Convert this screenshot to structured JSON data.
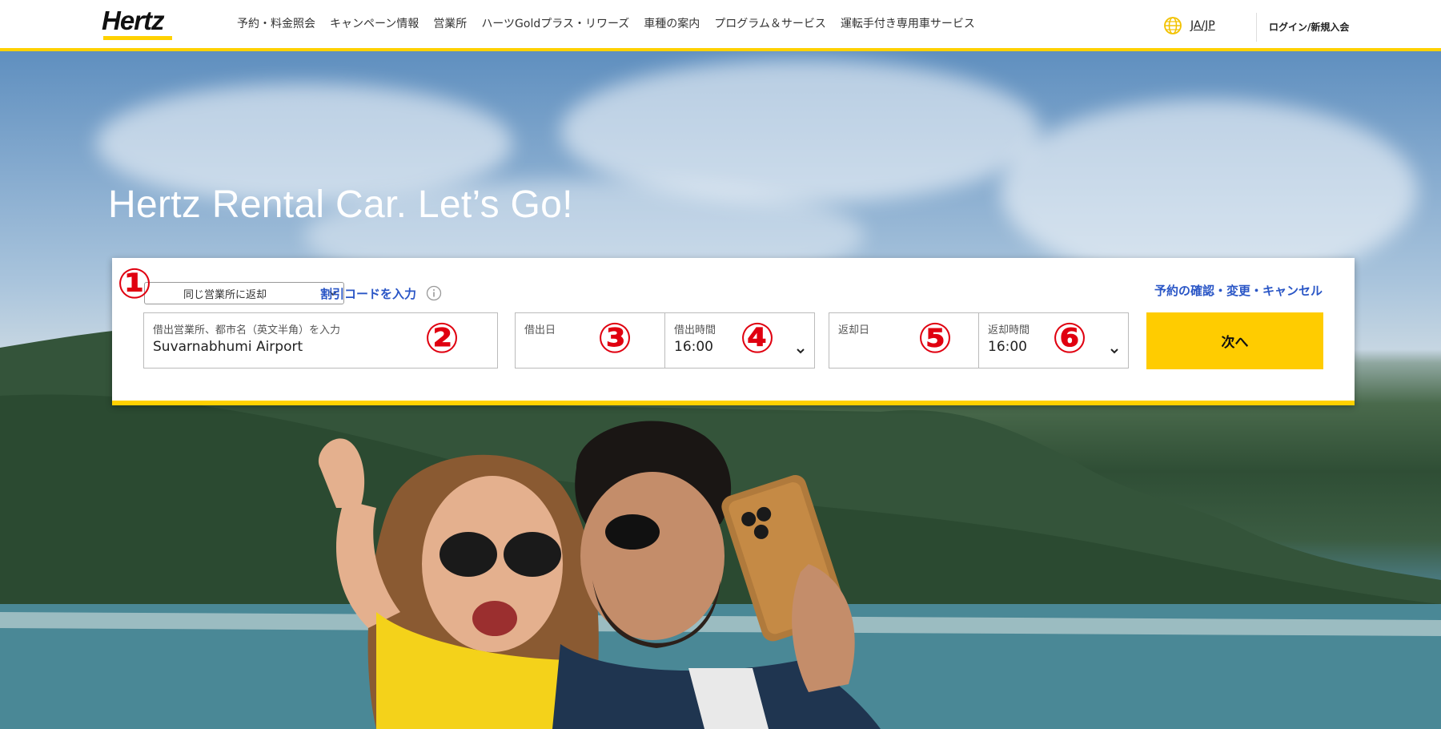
{
  "header": {
    "logo_text": "Hertz",
    "nav": [
      "予約・料金照会",
      "キャンペーン情報",
      "営業所",
      "ハーツGoldプラス・リワーズ",
      "車種の案内",
      "プログラム＆サービス",
      "運転手付き専用車サービス"
    ],
    "language": "JA/JP",
    "login": "ログイン/新規入会"
  },
  "hero": {
    "title": "Hertz Rental Car. Let’s Go!"
  },
  "booking": {
    "return_option": "同じ営業所に返却",
    "discount_link": "割引コードを入力",
    "manage_link": "予約の確認・変更・キャンセル",
    "location_label": "借出営業所、都市名（英文半角）を入力",
    "location_value": "Suvarnabhumi Airport",
    "pickup_date_label": "借出日",
    "pickup_date_value": "",
    "pickup_time_label": "借出時間",
    "pickup_time_value": "16:00",
    "return_date_label": "返却日",
    "return_date_value": "",
    "return_time_label": "返却時間",
    "return_time_value": "16:00",
    "next_label": "次へ"
  },
  "annotations": [
    "①",
    "②",
    "③",
    "④",
    "⑤",
    "⑥"
  ],
  "colors": {
    "brand_yellow": "#ffd100",
    "button_yellow": "#ffcc00",
    "link_blue": "#2a56c6",
    "annotation_red": "#e00010"
  }
}
